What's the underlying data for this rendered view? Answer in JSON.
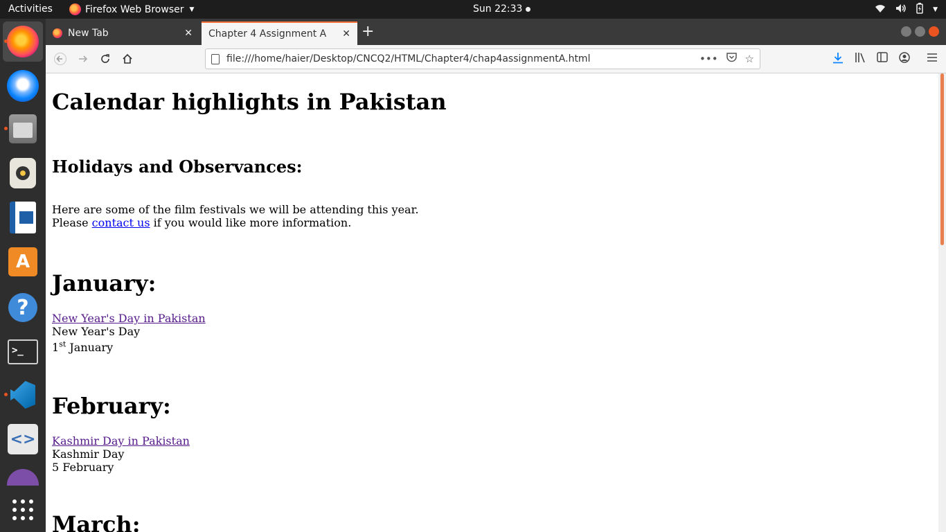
{
  "topbar": {
    "activities": "Activities",
    "app_name": "Firefox Web Browser",
    "clock": "Sun 22:33"
  },
  "dock": {
    "items": [
      "firefox",
      "thunderbird",
      "files",
      "rhythmbox",
      "libreoffice-writer",
      "ubuntu-software",
      "help",
      "terminal",
      "vscode",
      "code-editor",
      "cat-app",
      "show-applications"
    ]
  },
  "tabs": [
    {
      "title": "New Tab",
      "active": false
    },
    {
      "title": "Chapter 4 Assignment A",
      "active": true
    }
  ],
  "navbar": {
    "url": "file:///home/haier/Desktop/CNCQ2/HTML/Chapter4/chap4assignmentA.html"
  },
  "page": {
    "title": "Calendar highlights in Pakistan",
    "subtitle": "Holidays and Observances:",
    "intro_line1": "Here are some of the film festivals we will be attending this year.",
    "intro_please": "Please",
    "intro_link": "contact us",
    "intro_rest": "if you would like more information.",
    "months": [
      {
        "name": "January:",
        "link": "New Year's Day in Pakistan",
        "event": "New Year's Day",
        "date_num": "1",
        "date_sup": "st",
        "date_month": "January"
      },
      {
        "name": "February:",
        "link": "Kashmir Day in Pakistan",
        "event": "Kashmir Day",
        "date": "5 February"
      },
      {
        "name": "March:"
      }
    ]
  },
  "colors": {
    "link": "#0000ee",
    "visited": "#551a8b",
    "accent": "#e95420"
  }
}
